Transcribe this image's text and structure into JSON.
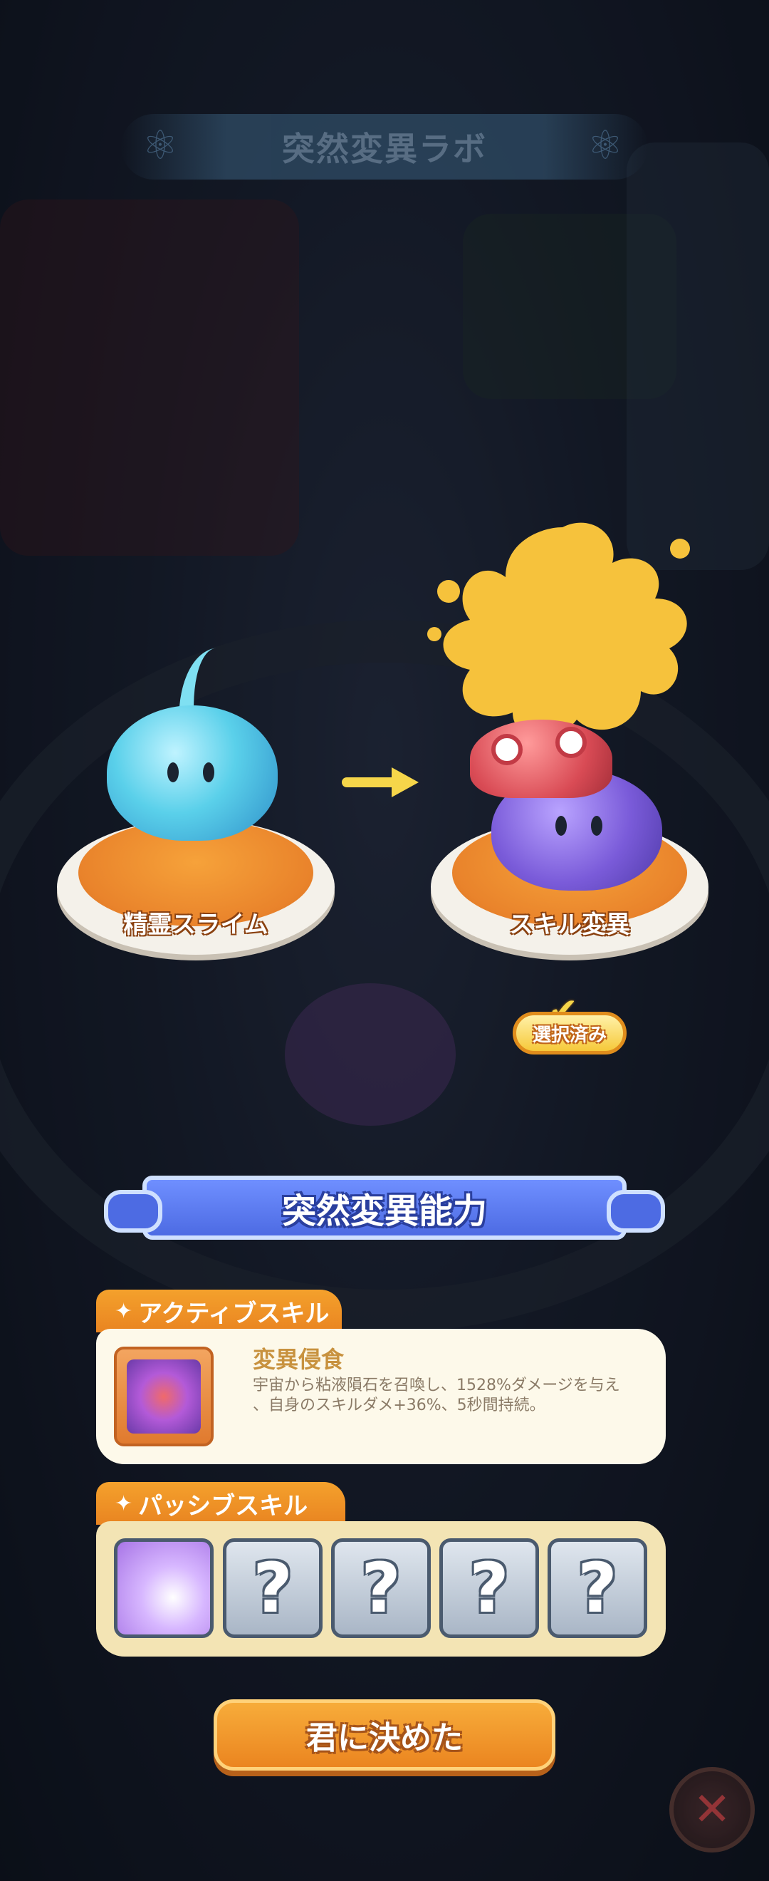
{
  "header": {
    "title": "突然変異ラボ"
  },
  "mutation": {
    "source_label": "精霊スライム",
    "target_label": "スキル変異",
    "selected_badge": "選択済み"
  },
  "ability": {
    "banner": "突然変異能力",
    "active": {
      "tab": "アクティブスキル",
      "name": "変異侵食",
      "desc_line1": "宇宙から粘液隕石を召喚し、1528%ダメージを与え",
      "desc_line2": "、自身のスキルダメ+36%、5秒間持続。"
    },
    "passive": {
      "tab": "パッシブスキル",
      "slots": [
        "filled",
        "?",
        "?",
        "?",
        "?"
      ]
    }
  },
  "footer": {
    "confirm_label": "君に決めた",
    "close_symbol": "✕"
  },
  "colors": {
    "accent_orange": "#eb8520",
    "banner_blue": "#4d6be3",
    "card_cream": "#fdf9ea"
  }
}
